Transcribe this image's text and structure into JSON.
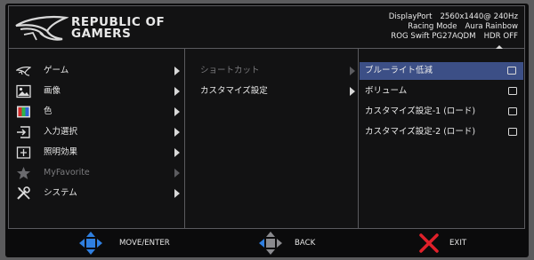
{
  "header": {
    "brand_line1": "REPUBLIC OF",
    "brand_line2": "GAMERS",
    "status": {
      "input": "DisplayPort",
      "resolution": "2560x1440@ 240Hz",
      "mode": "Racing Mode",
      "aura": "Aura Rainbow",
      "model": "ROG Swift  PG27AQDM",
      "hdr": "HDR OFF"
    }
  },
  "main_menu": [
    {
      "label": "ゲーム",
      "icon": "rog-logo-icon",
      "enabled": true
    },
    {
      "label": "画像",
      "icon": "image-icon",
      "enabled": true
    },
    {
      "label": "色",
      "icon": "color-bars-icon",
      "enabled": true
    },
    {
      "label": "入力選択",
      "icon": "input-icon",
      "enabled": true
    },
    {
      "label": "照明効果",
      "icon": "lighting-icon",
      "enabled": true
    },
    {
      "label": "MyFavorite",
      "icon": "star-icon",
      "enabled": false
    },
    {
      "label": "システム",
      "icon": "wrench-icon",
      "enabled": true
    }
  ],
  "sub_menu": [
    {
      "label": "ショートカット",
      "enabled": false
    },
    {
      "label": "カスタマイズ設定",
      "enabled": true
    }
  ],
  "options": [
    {
      "label": "ブルーライト低減",
      "selected": true
    },
    {
      "label": "ボリューム",
      "selected": false
    },
    {
      "label": "カスタマイズ設定-1 (ロード)",
      "selected": false
    },
    {
      "label": "カスタマイズ設定-2 (ロード)",
      "selected": false
    }
  ],
  "footer": {
    "move_label": "MOVE/ENTER",
    "back_label": "BACK",
    "exit_label": "EXIT"
  },
  "colors": {
    "highlight": "#3c4f86",
    "dpad_blue": "#2f7fe0",
    "exit_red": "#e0202a"
  }
}
